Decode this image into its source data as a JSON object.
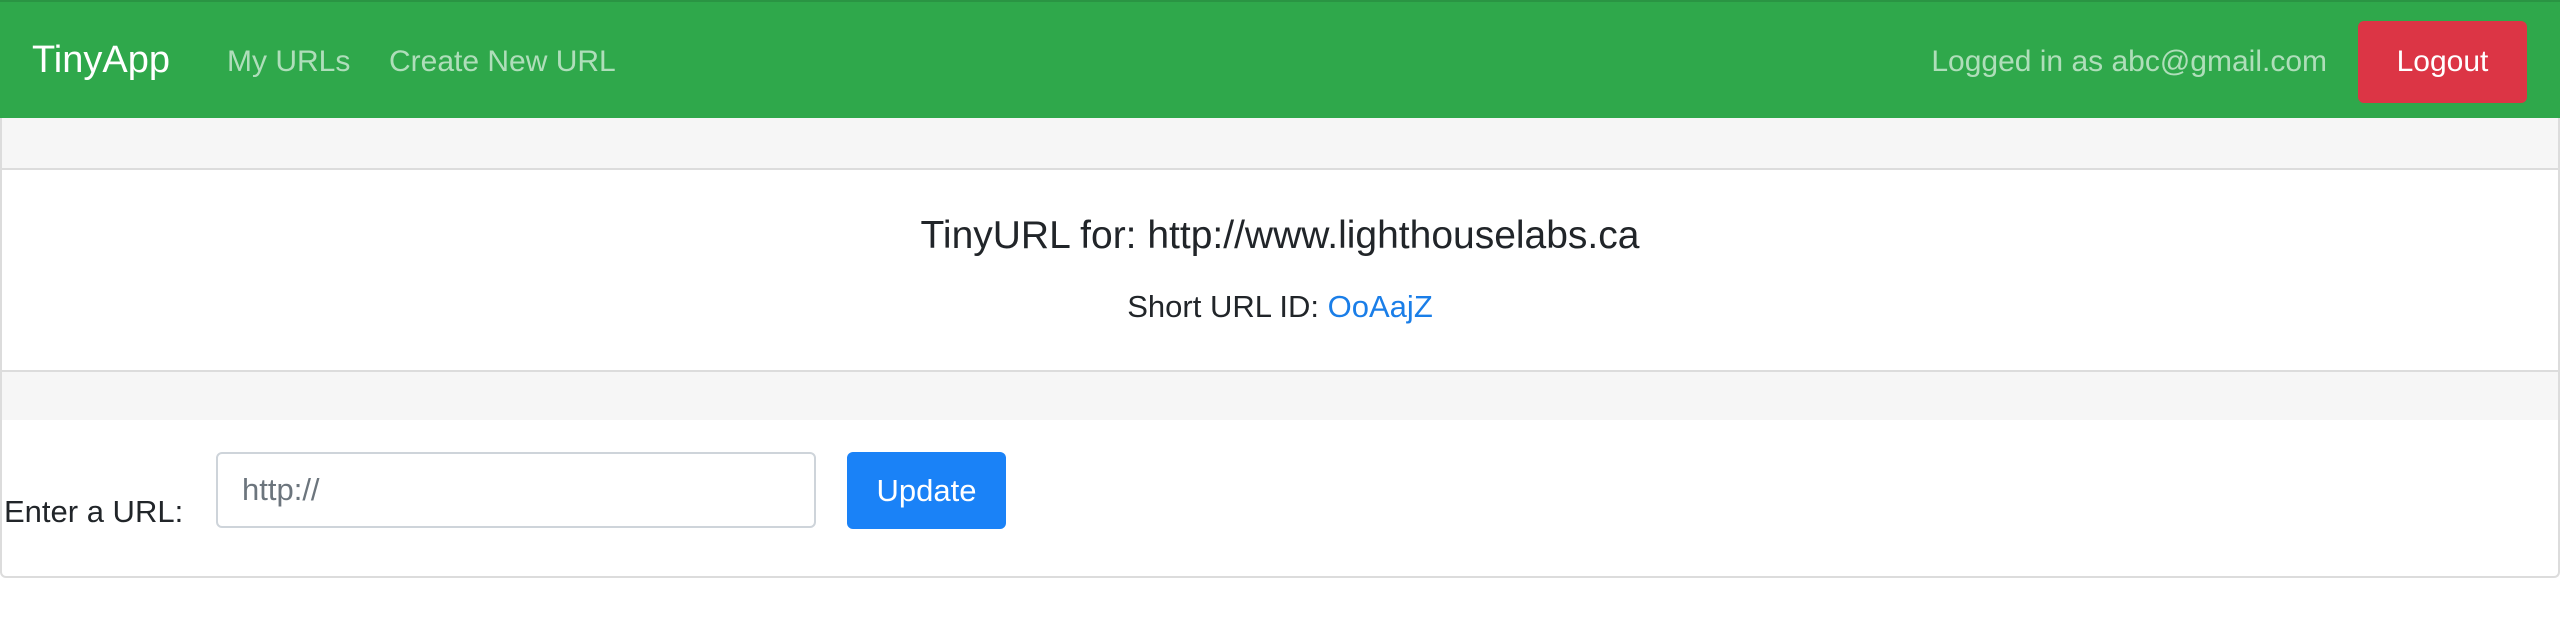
{
  "navbar": {
    "brand": "TinyApp",
    "links": [
      {
        "label": "My URLs"
      },
      {
        "label": "Create New URL"
      }
    ],
    "logged_in_text": "Logged in as abc@gmail.com",
    "logout_label": "Logout",
    "colors": {
      "background": "#2fa84b",
      "logout": "#dc3545"
    }
  },
  "card": {
    "title": "TinyURL for: http://www.lighthouselabs.ca",
    "short_url_label": "Short URL ID: ",
    "short_url_id": "OoAajZ"
  },
  "form": {
    "label": "Enter a URL:",
    "input_value": "",
    "input_placeholder": "http://",
    "submit_label": "Update",
    "colors": {
      "submit": "#1a82f7",
      "link": "#1a7ee8"
    }
  }
}
